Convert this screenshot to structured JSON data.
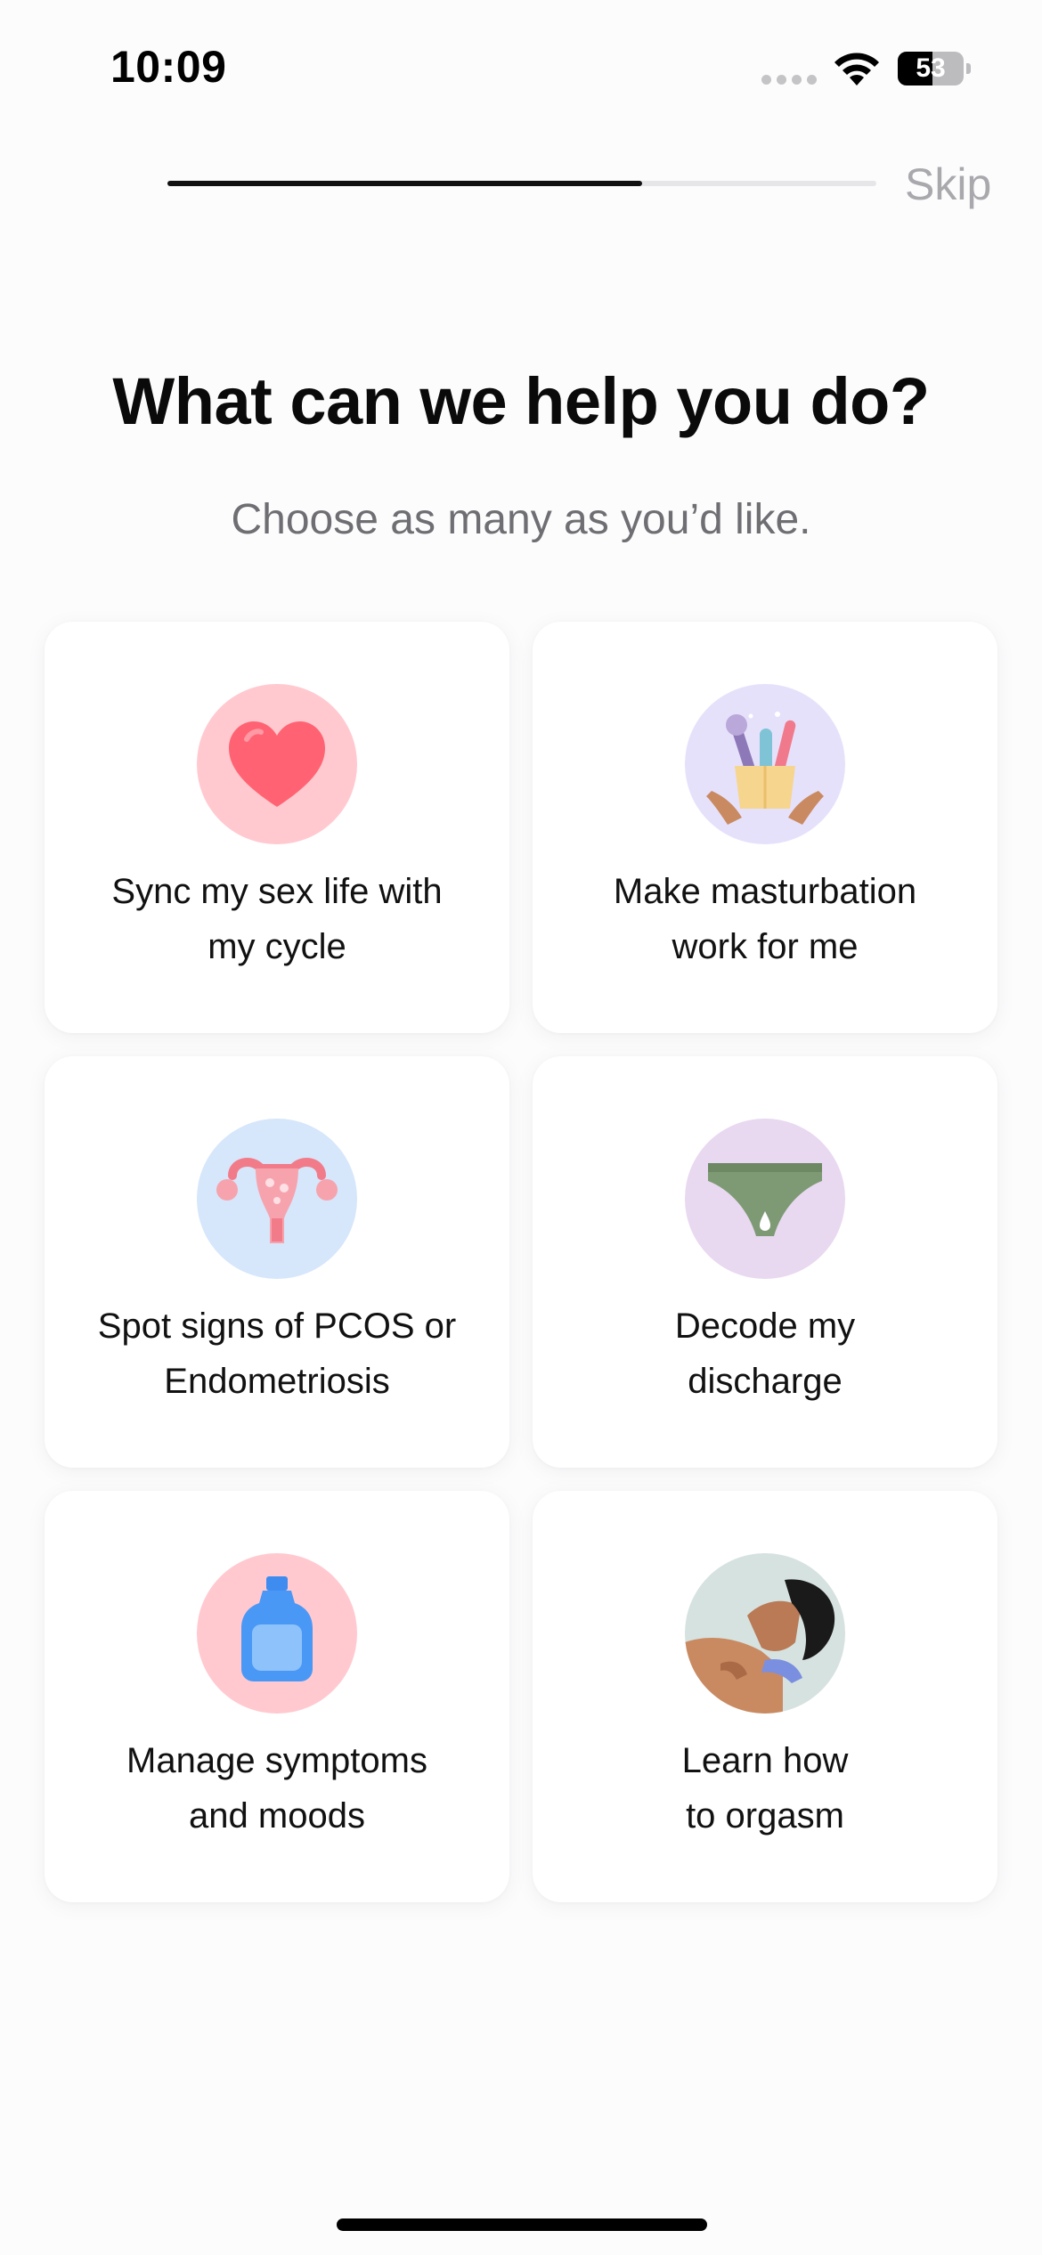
{
  "status_bar": {
    "time": "10:09",
    "battery_level": "53",
    "battery_fraction": 0.53
  },
  "progress": {
    "fraction": 0.67
  },
  "skip_label": "Skip",
  "title": "What can we help you do?",
  "subtitle": "Choose as many as you’d like.",
  "options": [
    {
      "label": "Sync my sex life with\nmy cycle",
      "icon": "heart-icon",
      "icon_bg": "#ffc9cf"
    },
    {
      "label": "Make masturbation\nwork for me",
      "icon": "toy-box-icon",
      "icon_bg": "#e6e1fb"
    },
    {
      "label": "Spot signs of PCOS or\nEndometriosis",
      "icon": "uterus-icon",
      "icon_bg": "#d6e6fb"
    },
    {
      "label": "Decode my\ndischarge",
      "icon": "underwear-icon",
      "icon_bg": "#e8d8f0"
    },
    {
      "label": "Manage symptoms\nand moods",
      "icon": "hot-water-bottle-icon",
      "icon_bg": "#ffc9cf"
    },
    {
      "label": "Learn how\nto orgasm",
      "icon": "woman-illustration-icon",
      "icon_bg": "#d6e2e0"
    }
  ],
  "colors": {
    "accent": "#111111",
    "skip": "#a9a9ad",
    "subtitle": "#6e6e73"
  }
}
